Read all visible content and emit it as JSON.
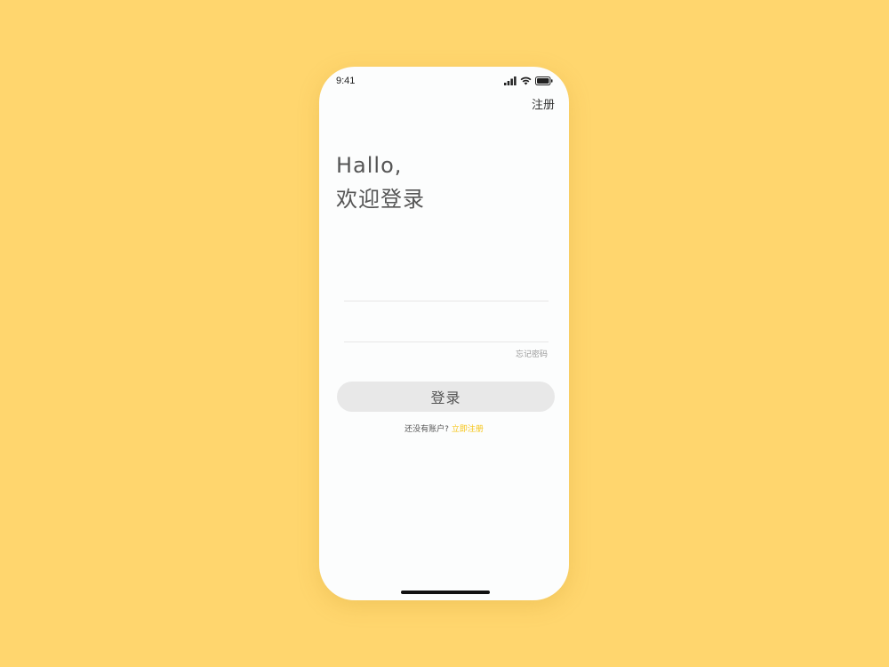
{
  "status_bar": {
    "time": "9:41"
  },
  "header": {
    "register_label": "注册"
  },
  "greeting": {
    "line1": "Hallo,",
    "line2": "欢迎登录"
  },
  "form": {
    "username_value": "",
    "password_value": "",
    "forgot_label": "忘记密码",
    "login_label": "登录",
    "no_account_text": "还没有账户?",
    "signup_link_label": "立即注册"
  },
  "colors": {
    "background": "#FFD66E",
    "card": "#FCFDFD",
    "accent": "#F5C518",
    "button": "#E8E8E8"
  }
}
